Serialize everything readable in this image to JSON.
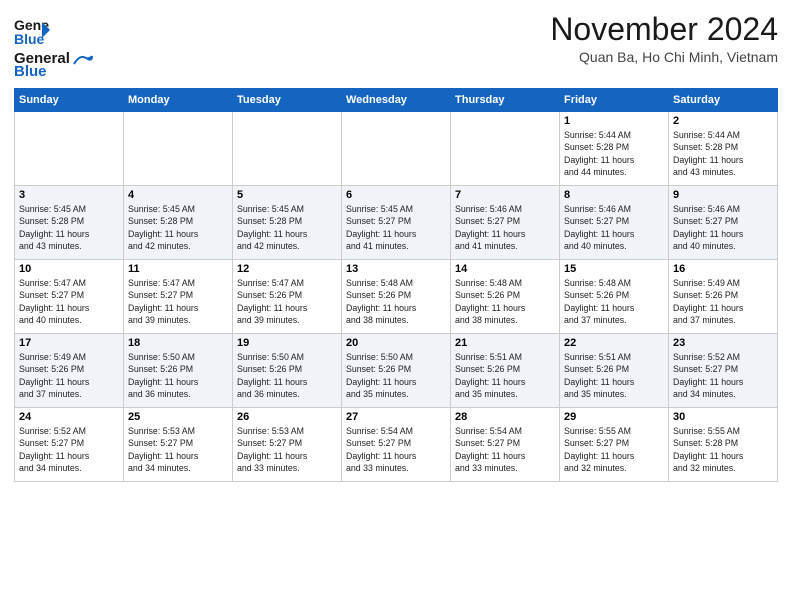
{
  "logo": {
    "line1": "General",
    "line2": "Blue",
    "tagline": ""
  },
  "header": {
    "month_title": "November 2024",
    "location": "Quan Ba, Ho Chi Minh, Vietnam"
  },
  "weekdays": [
    "Sunday",
    "Monday",
    "Tuesday",
    "Wednesday",
    "Thursday",
    "Friday",
    "Saturday"
  ],
  "weeks": [
    [
      {
        "day": "",
        "info": ""
      },
      {
        "day": "",
        "info": ""
      },
      {
        "day": "",
        "info": ""
      },
      {
        "day": "",
        "info": ""
      },
      {
        "day": "",
        "info": ""
      },
      {
        "day": "1",
        "info": "Sunrise: 5:44 AM\nSunset: 5:28 PM\nDaylight: 11 hours\nand 44 minutes."
      },
      {
        "day": "2",
        "info": "Sunrise: 5:44 AM\nSunset: 5:28 PM\nDaylight: 11 hours\nand 43 minutes."
      }
    ],
    [
      {
        "day": "3",
        "info": "Sunrise: 5:45 AM\nSunset: 5:28 PM\nDaylight: 11 hours\nand 43 minutes."
      },
      {
        "day": "4",
        "info": "Sunrise: 5:45 AM\nSunset: 5:28 PM\nDaylight: 11 hours\nand 42 minutes."
      },
      {
        "day": "5",
        "info": "Sunrise: 5:45 AM\nSunset: 5:28 PM\nDaylight: 11 hours\nand 42 minutes."
      },
      {
        "day": "6",
        "info": "Sunrise: 5:45 AM\nSunset: 5:27 PM\nDaylight: 11 hours\nand 41 minutes."
      },
      {
        "day": "7",
        "info": "Sunrise: 5:46 AM\nSunset: 5:27 PM\nDaylight: 11 hours\nand 41 minutes."
      },
      {
        "day": "8",
        "info": "Sunrise: 5:46 AM\nSunset: 5:27 PM\nDaylight: 11 hours\nand 40 minutes."
      },
      {
        "day": "9",
        "info": "Sunrise: 5:46 AM\nSunset: 5:27 PM\nDaylight: 11 hours\nand 40 minutes."
      }
    ],
    [
      {
        "day": "10",
        "info": "Sunrise: 5:47 AM\nSunset: 5:27 PM\nDaylight: 11 hours\nand 40 minutes."
      },
      {
        "day": "11",
        "info": "Sunrise: 5:47 AM\nSunset: 5:27 PM\nDaylight: 11 hours\nand 39 minutes."
      },
      {
        "day": "12",
        "info": "Sunrise: 5:47 AM\nSunset: 5:26 PM\nDaylight: 11 hours\nand 39 minutes."
      },
      {
        "day": "13",
        "info": "Sunrise: 5:48 AM\nSunset: 5:26 PM\nDaylight: 11 hours\nand 38 minutes."
      },
      {
        "day": "14",
        "info": "Sunrise: 5:48 AM\nSunset: 5:26 PM\nDaylight: 11 hours\nand 38 minutes."
      },
      {
        "day": "15",
        "info": "Sunrise: 5:48 AM\nSunset: 5:26 PM\nDaylight: 11 hours\nand 37 minutes."
      },
      {
        "day": "16",
        "info": "Sunrise: 5:49 AM\nSunset: 5:26 PM\nDaylight: 11 hours\nand 37 minutes."
      }
    ],
    [
      {
        "day": "17",
        "info": "Sunrise: 5:49 AM\nSunset: 5:26 PM\nDaylight: 11 hours\nand 37 minutes."
      },
      {
        "day": "18",
        "info": "Sunrise: 5:50 AM\nSunset: 5:26 PM\nDaylight: 11 hours\nand 36 minutes."
      },
      {
        "day": "19",
        "info": "Sunrise: 5:50 AM\nSunset: 5:26 PM\nDaylight: 11 hours\nand 36 minutes."
      },
      {
        "day": "20",
        "info": "Sunrise: 5:50 AM\nSunset: 5:26 PM\nDaylight: 11 hours\nand 35 minutes."
      },
      {
        "day": "21",
        "info": "Sunrise: 5:51 AM\nSunset: 5:26 PM\nDaylight: 11 hours\nand 35 minutes."
      },
      {
        "day": "22",
        "info": "Sunrise: 5:51 AM\nSunset: 5:26 PM\nDaylight: 11 hours\nand 35 minutes."
      },
      {
        "day": "23",
        "info": "Sunrise: 5:52 AM\nSunset: 5:27 PM\nDaylight: 11 hours\nand 34 minutes."
      }
    ],
    [
      {
        "day": "24",
        "info": "Sunrise: 5:52 AM\nSunset: 5:27 PM\nDaylight: 11 hours\nand 34 minutes."
      },
      {
        "day": "25",
        "info": "Sunrise: 5:53 AM\nSunset: 5:27 PM\nDaylight: 11 hours\nand 34 minutes."
      },
      {
        "day": "26",
        "info": "Sunrise: 5:53 AM\nSunset: 5:27 PM\nDaylight: 11 hours\nand 33 minutes."
      },
      {
        "day": "27",
        "info": "Sunrise: 5:54 AM\nSunset: 5:27 PM\nDaylight: 11 hours\nand 33 minutes."
      },
      {
        "day": "28",
        "info": "Sunrise: 5:54 AM\nSunset: 5:27 PM\nDaylight: 11 hours\nand 33 minutes."
      },
      {
        "day": "29",
        "info": "Sunrise: 5:55 AM\nSunset: 5:27 PM\nDaylight: 11 hours\nand 32 minutes."
      },
      {
        "day": "30",
        "info": "Sunrise: 5:55 AM\nSunset: 5:28 PM\nDaylight: 11 hours\nand 32 minutes."
      }
    ]
  ]
}
